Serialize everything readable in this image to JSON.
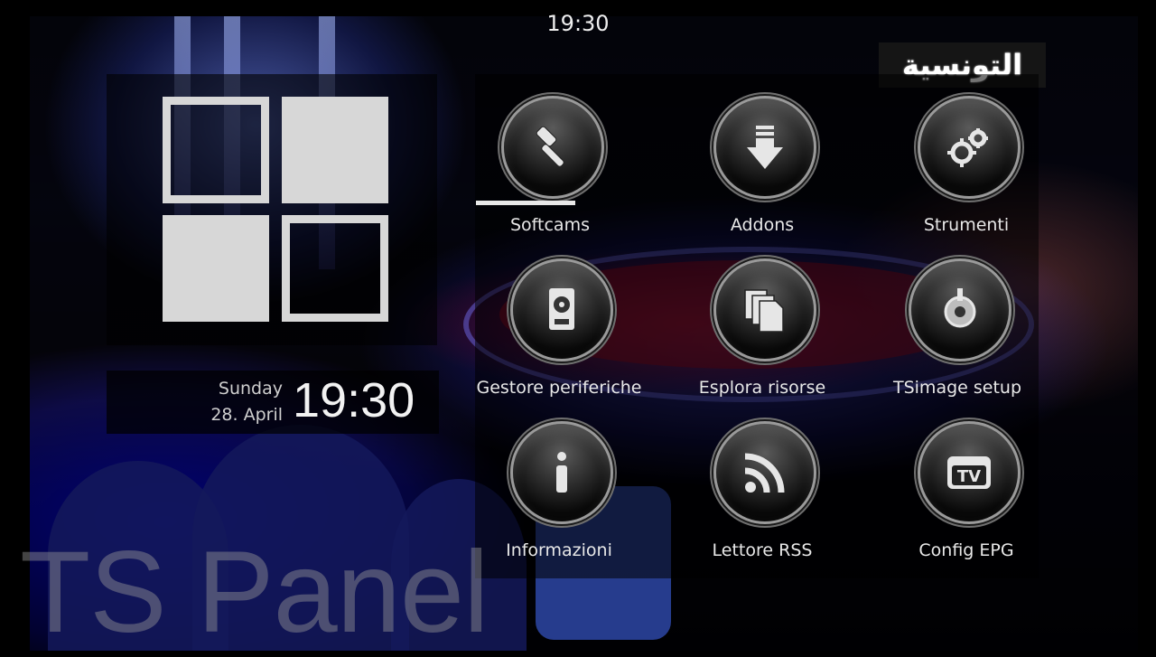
{
  "top_clock": "19:30",
  "channel_logo_text": "التونسية",
  "datetime": {
    "weekday": "Sunday",
    "date": "28. April",
    "time": "19:30"
  },
  "menu": {
    "selected_index": 0,
    "items": [
      {
        "label": "Softcams",
        "icon": "hammer-tools-icon"
      },
      {
        "label": "Addons",
        "icon": "download-arrow-icon"
      },
      {
        "label": "Strumenti",
        "icon": "gears-icon"
      },
      {
        "label": "Gestore periferiche",
        "icon": "hard-drive-icon"
      },
      {
        "label": "Esplora risorse",
        "icon": "file-explorer-icon"
      },
      {
        "label": "TSimage setup",
        "icon": "power-dial-icon"
      },
      {
        "label": "Informazioni",
        "icon": "info-icon"
      },
      {
        "label": "Lettore RSS",
        "icon": "rss-feed-icon"
      },
      {
        "label": "Config EPG",
        "icon": "as-seen-on-tv-icon"
      }
    ]
  },
  "footer_title": "TS Panel",
  "colors": {
    "tile": "#d7d7d7",
    "text": "#e8e8e8",
    "panel_bg": "rgba(0,0,0,0.55)"
  }
}
